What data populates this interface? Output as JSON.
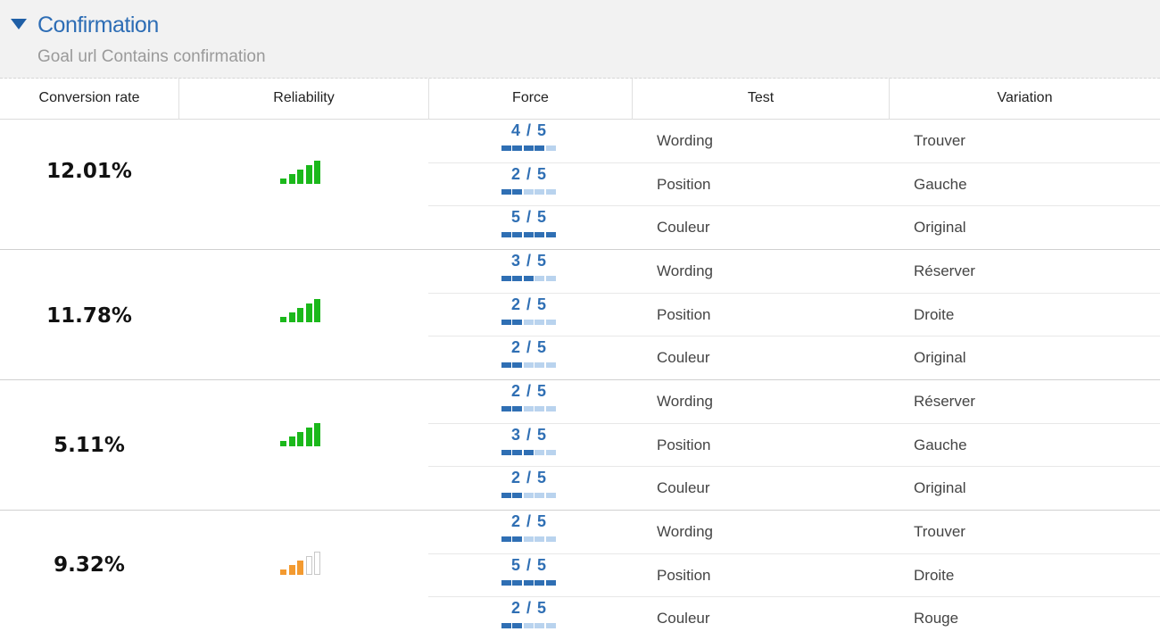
{
  "goal": {
    "title": "Confirmation",
    "subtitle": "Goal url Contains confirmation"
  },
  "columns": [
    "Conversion rate",
    "Reliability",
    "Force",
    "Test",
    "Variation"
  ],
  "colors": {
    "title_blue": "#2d6db5",
    "force_filled": "#2f6fb4",
    "force_empty": "#b9d3ee",
    "reliability_good": "#1bb81b",
    "reliability_weak": "#f39a30",
    "reliability_empty_outline": "#c8c8c8"
  },
  "groups": [
    {
      "rate": "12.01%",
      "reliability": {
        "level": 5,
        "max": 5,
        "status": "good"
      },
      "rows": [
        {
          "force": "4 / 5",
          "force_value": 4,
          "test": "Wording",
          "variation": "Trouver"
        },
        {
          "force": "2 / 5",
          "force_value": 2,
          "test": "Position",
          "variation": "Gauche"
        },
        {
          "force": "5 / 5",
          "force_value": 5,
          "test": "Couleur",
          "variation": "Original"
        }
      ]
    },
    {
      "rate": "11.78%",
      "reliability": {
        "level": 5,
        "max": 5,
        "status": "good"
      },
      "rows": [
        {
          "force": "3 / 5",
          "force_value": 3,
          "test": "Wording",
          "variation": "Réserver"
        },
        {
          "force": "2 / 5",
          "force_value": 2,
          "test": "Position",
          "variation": "Droite"
        },
        {
          "force": "2 / 5",
          "force_value": 2,
          "test": "Couleur",
          "variation": "Original"
        }
      ]
    },
    {
      "rate": "5.11%",
      "reliability": {
        "level": 5,
        "max": 5,
        "status": "good"
      },
      "rows": [
        {
          "force": "2 / 5",
          "force_value": 2,
          "test": "Wording",
          "variation": "Réserver"
        },
        {
          "force": "3 / 5",
          "force_value": 3,
          "test": "Position",
          "variation": "Gauche"
        },
        {
          "force": "2 / 5",
          "force_value": 2,
          "test": "Couleur",
          "variation": "Original"
        }
      ]
    },
    {
      "rate": "9.32%",
      "reliability": {
        "level": 3,
        "max": 5,
        "status": "weak"
      },
      "rows": [
        {
          "force": "2 / 5",
          "force_value": 2,
          "test": "Wording",
          "variation": "Trouver"
        },
        {
          "force": "5 / 5",
          "force_value": 5,
          "test": "Position",
          "variation": "Droite"
        },
        {
          "force": "2 / 5",
          "force_value": 2,
          "test": "Couleur",
          "variation": "Rouge"
        }
      ]
    }
  ]
}
